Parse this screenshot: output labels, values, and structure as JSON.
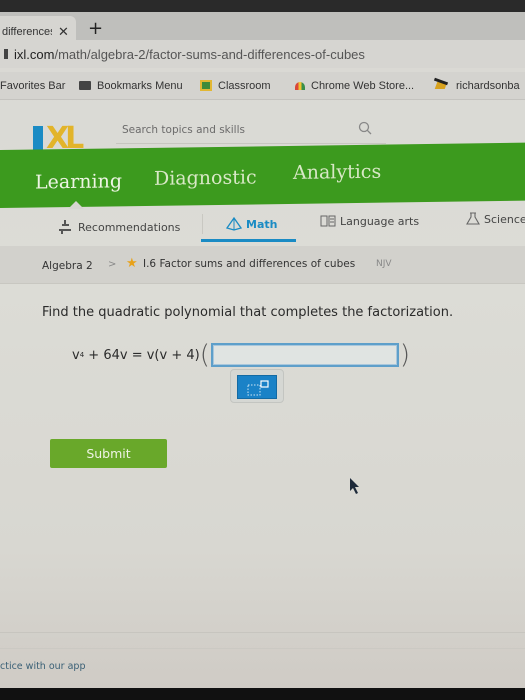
{
  "browser": {
    "tab": {
      "title": "differences",
      "close_glyph": "✕"
    },
    "new_tab_glyph": "+",
    "url_host": "ixl.com",
    "url_path": "/math/algebra-2/factor-sums-and-differences-of-cubes",
    "bookmarks": [
      {
        "label": "Favorites Bar",
        "icon": "none"
      },
      {
        "label": "Bookmarks Menu",
        "icon": "folder-icon"
      },
      {
        "label": "Classroom",
        "icon": "classroom-icon"
      },
      {
        "label": "Chrome Web Store...",
        "icon": "chrome-web-store-icon"
      },
      {
        "label": "richardsonba",
        "icon": "viking-icon"
      }
    ]
  },
  "header": {
    "logo_text": "XL",
    "search_placeholder": "Search topics and skills"
  },
  "nav": {
    "items": [
      {
        "label": "Learning",
        "active": true
      },
      {
        "label": "Diagnostic",
        "active": false
      },
      {
        "label": "Analytics",
        "active": false
      }
    ]
  },
  "subjects": [
    {
      "label": "Recommendations",
      "icon": "recommendations-icon",
      "active": false
    },
    {
      "label": "Math",
      "icon": "pyramid-icon",
      "active": true
    },
    {
      "label": "Language arts",
      "icon": "book-icon",
      "active": false
    },
    {
      "label": "Science",
      "icon": "flask-icon",
      "active": false
    }
  ],
  "breadcrumb": {
    "course": "Algebra 2",
    "separator": ">",
    "skill": "I.6 Factor sums and differences of cubes",
    "code": "NJV"
  },
  "question": {
    "prompt": "Find the quadratic polynomial that completes the factorization.",
    "lhs_base": "v",
    "lhs_exp": "4",
    "lhs_rest": " + 64v = v(v + 4)",
    "paren_open": "(",
    "paren_close": ")",
    "answer_value": "",
    "submit_label": "Submit"
  },
  "footer": {
    "app_text": "ctice with our app"
  },
  "colors": {
    "green_nav": "#3c9a1e",
    "submit_green": "#69a82a",
    "ixl_blue": "#1a8bc4",
    "ixl_yellow": "#e2b42a",
    "star": "#e8a21a"
  }
}
